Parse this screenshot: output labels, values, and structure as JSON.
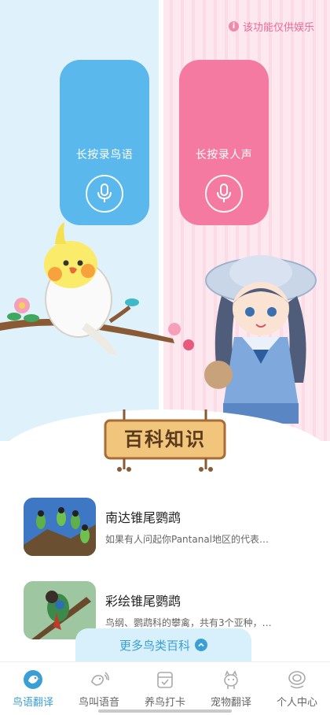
{
  "notice": {
    "text": "该功能仅供娱乐"
  },
  "record": {
    "bird_label": "长按录鸟语",
    "human_label": "长按录人声"
  },
  "section": {
    "title": "百科知识"
  },
  "articles": [
    {
      "title": "南达锥尾鹦鹉",
      "desc": "如果有人问起你Pantanal地区的代表…"
    },
    {
      "title": "彩绘锥尾鹦鹉",
      "desc": "鸟纲、鹦鹉科的攀禽，共有3个亚种，…"
    }
  ],
  "more": {
    "label": "更多鸟类百科"
  },
  "tabs": [
    {
      "label": "鸟语翻译",
      "icon": "bird-translate-icon",
      "active": true
    },
    {
      "label": "鸟叫语音",
      "icon": "bird-sound-icon",
      "active": false
    },
    {
      "label": "养鸟打卡",
      "icon": "checkin-icon",
      "active": false
    },
    {
      "label": "宠物翻译",
      "icon": "pet-translate-icon",
      "active": false
    },
    {
      "label": "个人中心",
      "icon": "profile-icon",
      "active": false
    }
  ],
  "colors": {
    "bird_card": "#5ab8ec",
    "human_card": "#f57aa2",
    "accent": "#3a9fd6",
    "notice": "#ec6a93"
  }
}
